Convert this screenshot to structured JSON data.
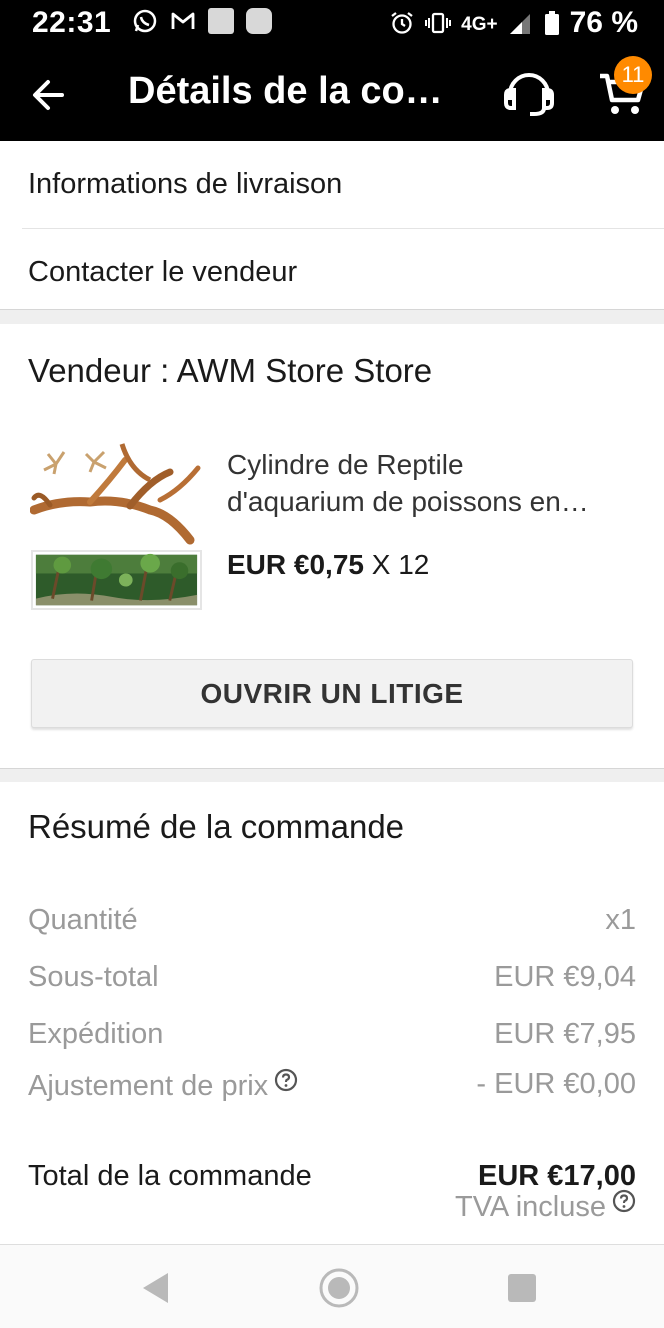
{
  "status_bar": {
    "time": "22:31",
    "network": "4G+",
    "battery": "76 %",
    "icons": [
      "whatsapp-icon",
      "gmail-icon",
      "notification-square-icon",
      "notification-rounded-icon",
      "alarm-icon",
      "vibrate-icon",
      "signal-icon",
      "battery-icon"
    ]
  },
  "app_bar": {
    "title": "Détails de la co…",
    "cart_count": "11",
    "icons": [
      "back-arrow-icon",
      "headset-icon",
      "cart-icon"
    ],
    "badge_color": "#ff8a00"
  },
  "menu": {
    "items": [
      {
        "label": "Informations de livraison"
      },
      {
        "label": "Contacter le vendeur"
      }
    ]
  },
  "vendor": {
    "title": "Vendeur : AWM Store Store",
    "product": {
      "name_line1": "Cylindre de Reptile",
      "name_line2": "d'aquarium de poissons en…",
      "price": "EUR €0,75",
      "quantity": "X 12"
    },
    "dispute_button": "OUVRIR UN LITIGE"
  },
  "summary": {
    "title": "Résumé de la commande",
    "rows": [
      {
        "label": "Quantité",
        "value": "x1"
      },
      {
        "label": "Sous-total",
        "value": "EUR €9,04"
      },
      {
        "label": "Expédition",
        "value": "EUR €7,95"
      },
      {
        "label": "Ajustement de prix",
        "value": "- EUR €0,00"
      }
    ],
    "total_label": "Total de la commande",
    "total_value": "EUR €17,00",
    "tva": "TVA incluse"
  },
  "nav_bar": {
    "icons": [
      "nav-back-icon",
      "nav-home-icon",
      "nav-recent-icon"
    ]
  }
}
